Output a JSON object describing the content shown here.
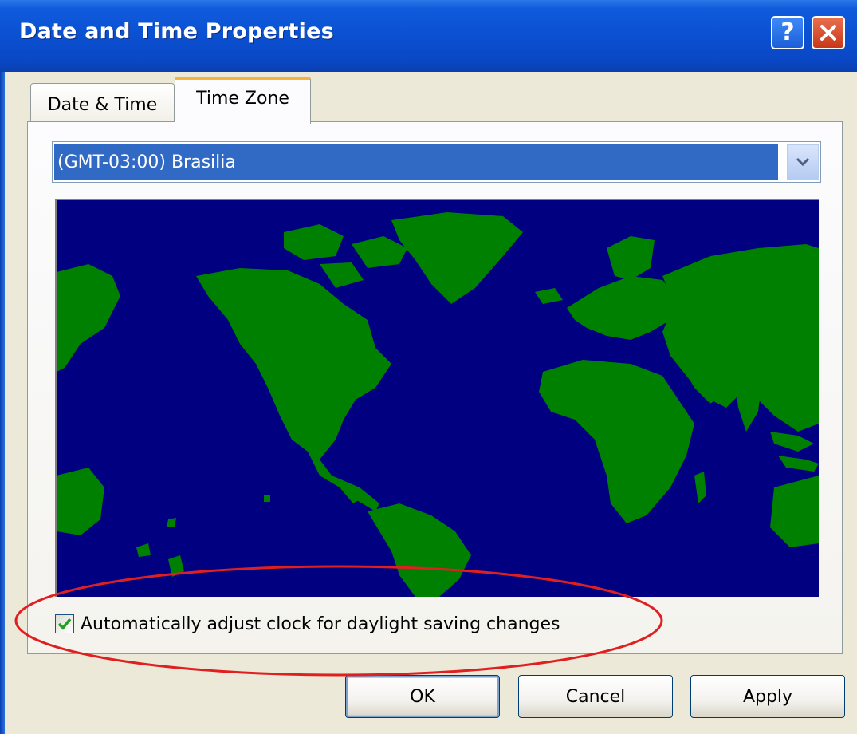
{
  "window": {
    "title": "Date and Time Properties",
    "help_icon": "help-icon",
    "close_icon": "close-icon"
  },
  "tabs": [
    {
      "label": "Date & Time",
      "active": false
    },
    {
      "label": "Time Zone",
      "active": true
    }
  ],
  "time_zone": {
    "selected": "(GMT-03:00) Brasilia",
    "dropdown_icon": "chevron-down-icon"
  },
  "map": {
    "ocean_color": "#000080",
    "land_color": "#008000"
  },
  "daylight_saving": {
    "label": "Automatically adjust clock for daylight saving changes",
    "checked": true
  },
  "buttons": {
    "ok": "OK",
    "cancel": "Cancel",
    "apply": "Apply"
  },
  "annotation": {
    "type": "ellipse",
    "color": "#E02020"
  }
}
